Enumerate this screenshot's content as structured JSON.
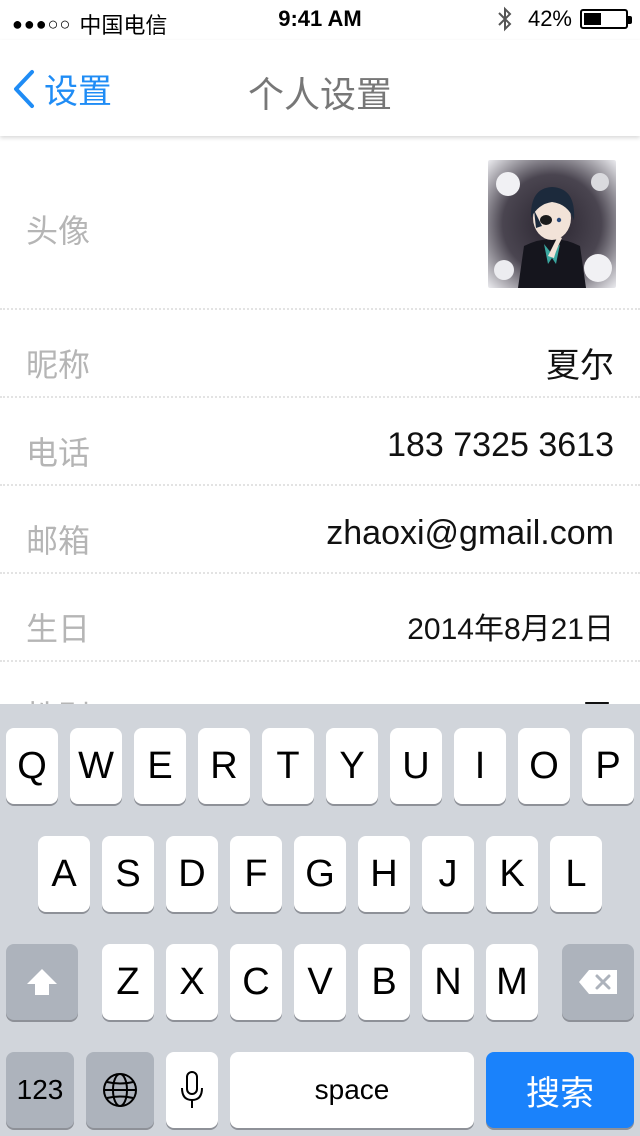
{
  "status_bar": {
    "signal": "●●●○○",
    "carrier": "中国电信",
    "time": "9:41 AM",
    "battery_percent": "42%",
    "battery_level": 0.42
  },
  "nav": {
    "back_label": "设置",
    "title": "个人设置"
  },
  "profile": {
    "avatar_label": "头像",
    "nickname_label": "昵称",
    "nickname_value": "夏尔",
    "phone_label": "电话",
    "phone_value": "183 7325 3613",
    "email_label": "邮箱",
    "email_value": "zhaoxi@gmail.com",
    "birthday_label": "生日",
    "birthday_value": "2014年8月21日",
    "gender_label": "性别",
    "gender_value": "男"
  },
  "keyboard": {
    "row1": [
      "Q",
      "W",
      "E",
      "R",
      "T",
      "Y",
      "U",
      "I",
      "O",
      "P"
    ],
    "row2": [
      "A",
      "S",
      "D",
      "F",
      "G",
      "H",
      "J",
      "K",
      "L"
    ],
    "row3": [
      "Z",
      "X",
      "C",
      "V",
      "B",
      "N",
      "M"
    ],
    "numbers_label": "123",
    "space_label": "space",
    "search_label": "搜索"
  },
  "colors": {
    "accent": "#1f8cf5",
    "search_key": "#1a82fb",
    "keyboard_bg": "#d1d5db"
  }
}
